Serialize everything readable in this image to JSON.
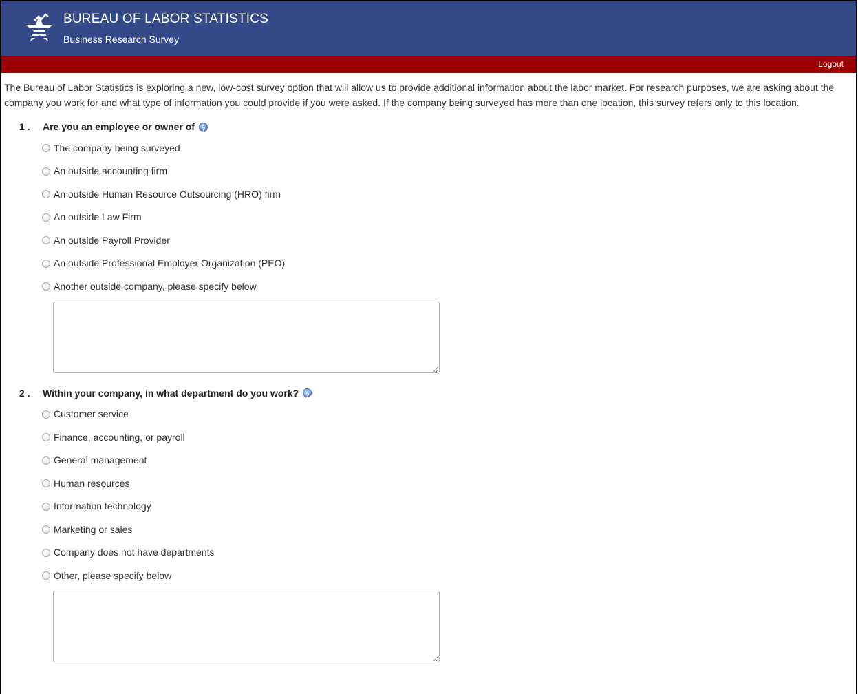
{
  "header": {
    "agency": "BUREAU OF LABOR STATISTICS",
    "subtitle": "Business Research Survey",
    "logo_icon": "bls-star-logo-icon"
  },
  "nav": {
    "logout_label": "Logout"
  },
  "intro": "The Bureau of Labor Statistics is exploring a new, low-cost survey option that will allow us to provide additional information about the labor market. For research purposes, we are asking about the company you work for and what type of information you could provide if you were asked. If the company being surveyed has more than one location, this survey refers only to this location.",
  "questions": [
    {
      "number": "1 .",
      "text": "Are you an employee or owner of",
      "options": [
        "The company being surveyed",
        "An outside accounting firm",
        "An outside Human Resource Outsourcing (HRO) firm",
        "An outside Law Firm",
        "An outside Payroll Provider",
        "An outside Professional Employer Organization (PEO)",
        "Another outside company, please specify below"
      ]
    },
    {
      "number": "2 .",
      "text": "Within your company, in what department do you work?",
      "options": [
        "Customer service",
        "Finance, accounting, or payroll",
        "General management",
        "Human resources",
        "Information technology",
        "Marketing or sales",
        "Company does not have departments",
        "Other, please specify below"
      ]
    }
  ],
  "colors": {
    "header_bg": "#354887",
    "bar_bg": "#9c0000"
  }
}
